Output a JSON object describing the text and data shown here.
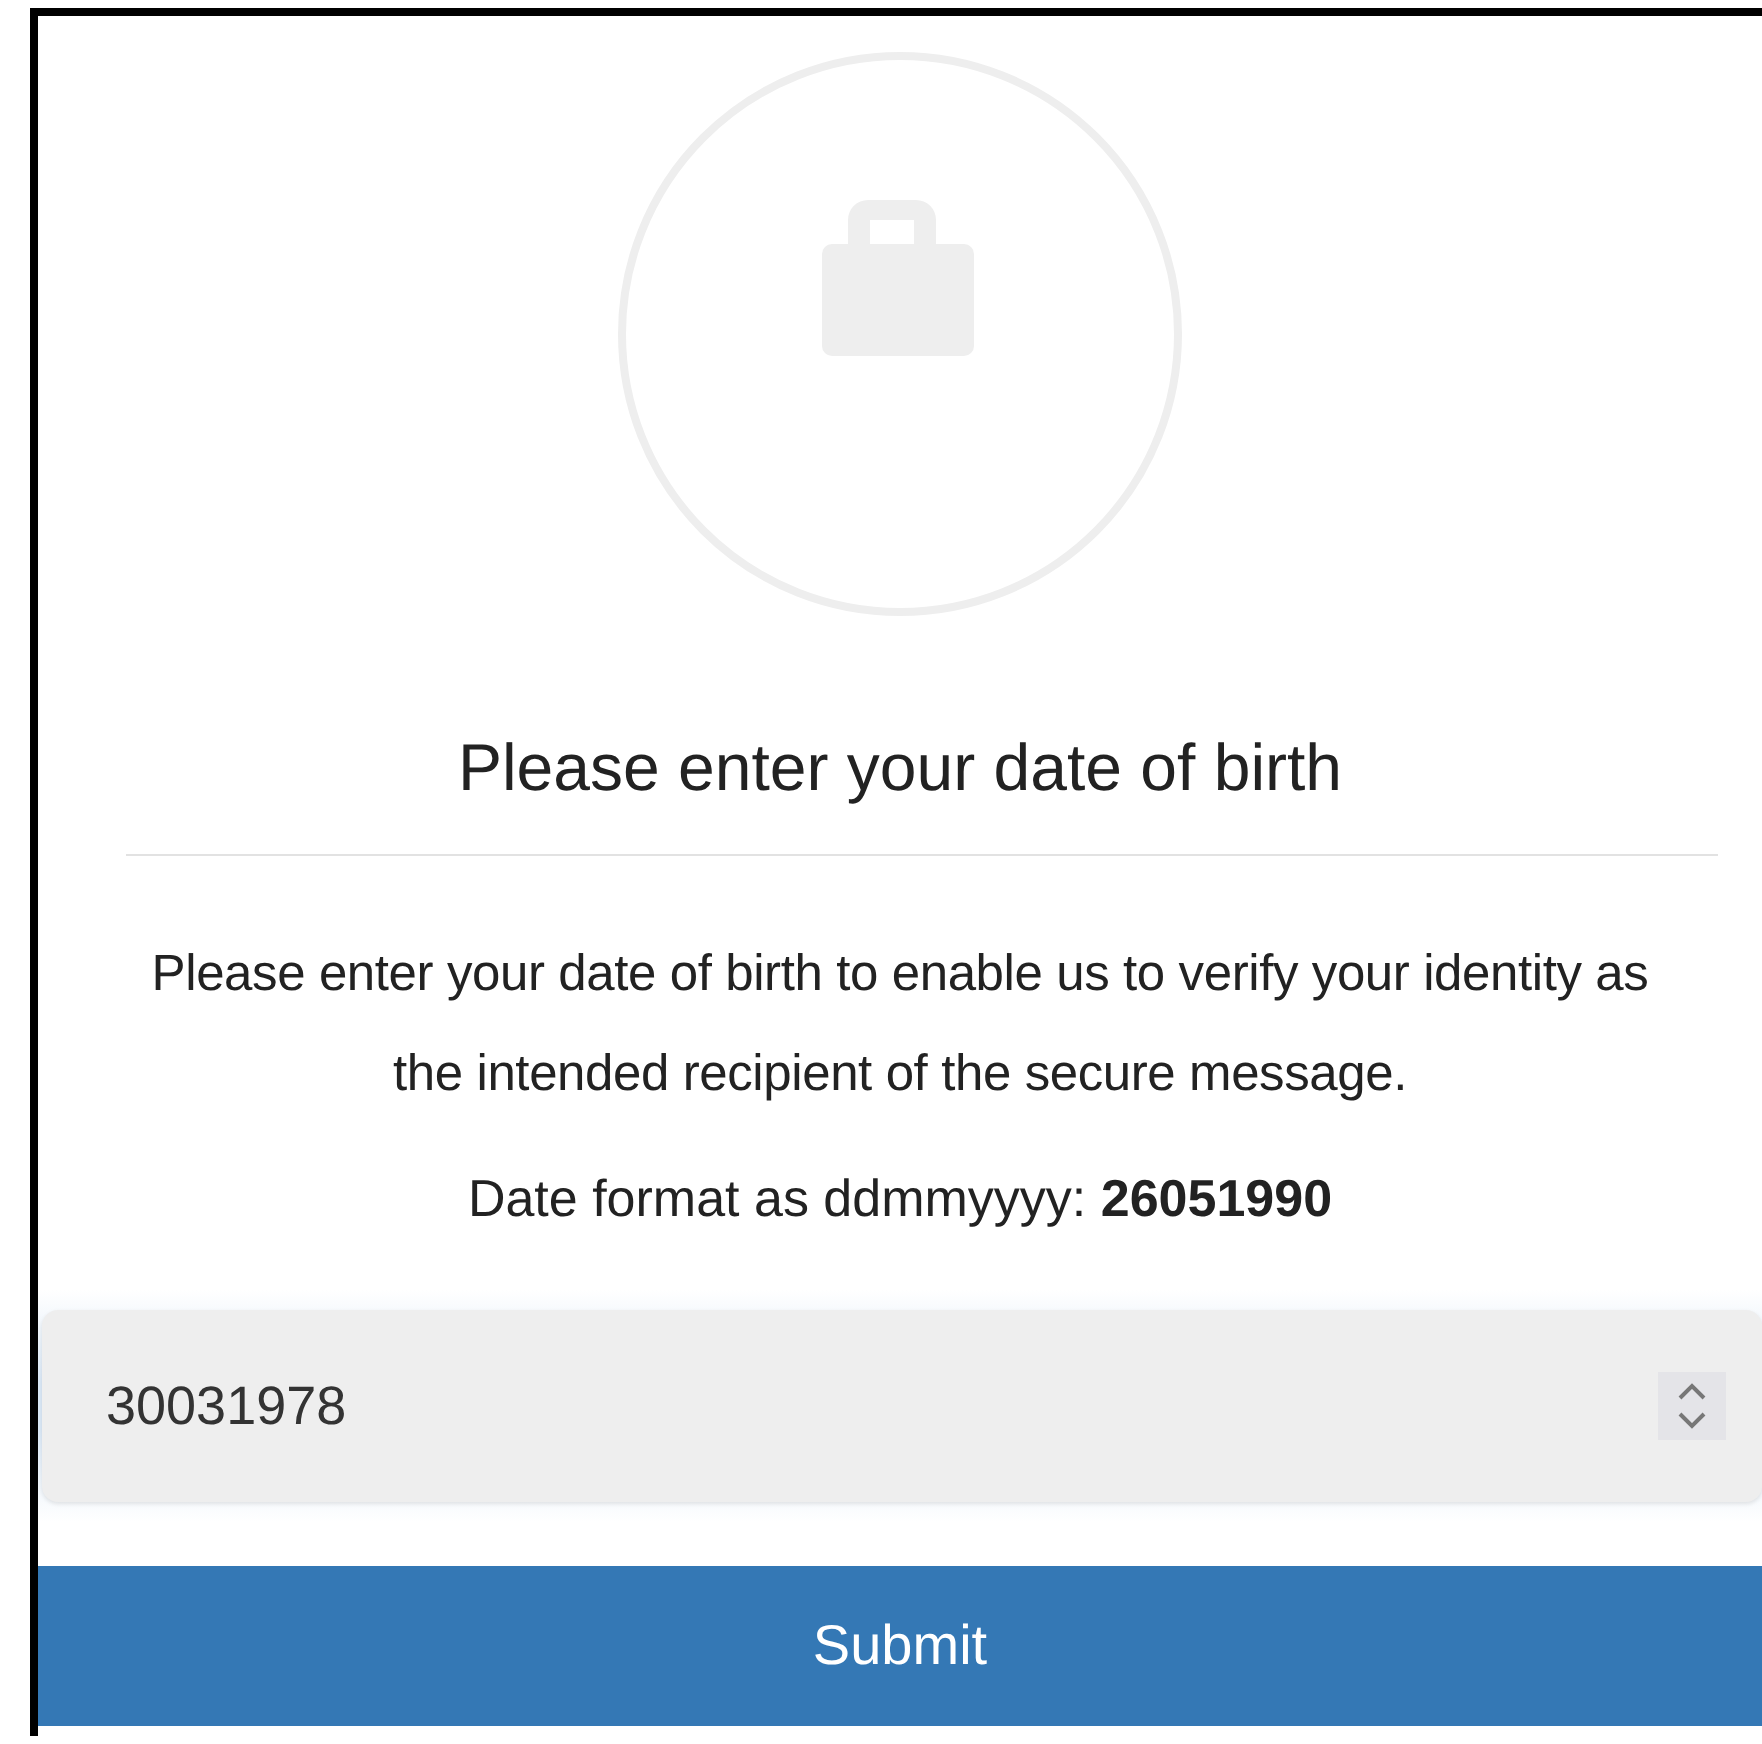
{
  "heading": "Please enter your date of birth",
  "instructions": "Please enter your date of birth to enable us to verify your identity as the intended recipient of the secure message.",
  "format_hint": "Date format as ddmmyyyy: **26051990**",
  "date_field": {
    "value": "30031978"
  },
  "submit_button": {
    "label": "Submit"
  }
}
